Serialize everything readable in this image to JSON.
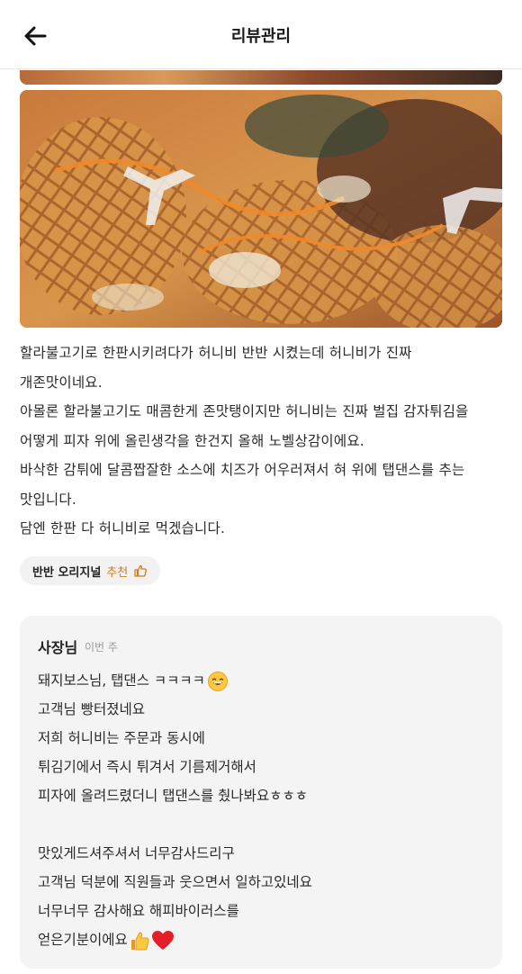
{
  "header": {
    "title": "리뷰관리"
  },
  "review": {
    "lines": [
      "할라불고기로 한판시키려다가 허니비 반반 시켰는데 허니비가 진짜",
      "개존맛이네요.",
      "아몰론 할라불고기도 매콤한게 존맛탱이지만 허니비는 진짜 벌집 감자튀김을",
      "어떻게 피자 위에 올린생각을 한건지 올해 노벨상감이에요.",
      "바삭한 감튀에 달콤짭잘한 소스에 치즈가 어우러져서 혀 위에 탭댄스를 추는",
      "맛입니다.",
      "담엔 한판 다 허니비로 먹겠습니다."
    ]
  },
  "menu_chip": {
    "name": "반반 오리지널",
    "recommend": "추천"
  },
  "reply": {
    "author": "사장님",
    "time": "이번 주",
    "lines": [
      "돼지보스님, 탭댄스 ㅋㅋㅋㅋ",
      "고객님 빵터졌네요",
      "저희 허니비는 주문과 동시에",
      "튀김기에서 즉시 튀겨서 기름제거해서",
      "피자에 올려드렸더니 탭댄스를 췄나봐요ㅎㅎㅎ",
      "",
      "맛있게드셔주셔서 너무감사드리구",
      "고객님 덕분에 직원들과 웃으면서 일하고있네요",
      "너무너무 감사해요 해피바이러스를",
      "얻은기분이에요"
    ]
  },
  "icons": {
    "back": "arrow-left-icon",
    "recommend": "thumbs-up-icon",
    "emoji_laugh": "grin-emoji-icon",
    "thumbs": "thumbs-up-emoji-icon",
    "heart": "heart-emoji-icon"
  },
  "colors": {
    "accent": "#d07a1e",
    "reply_bg": "#f4f4f4"
  }
}
